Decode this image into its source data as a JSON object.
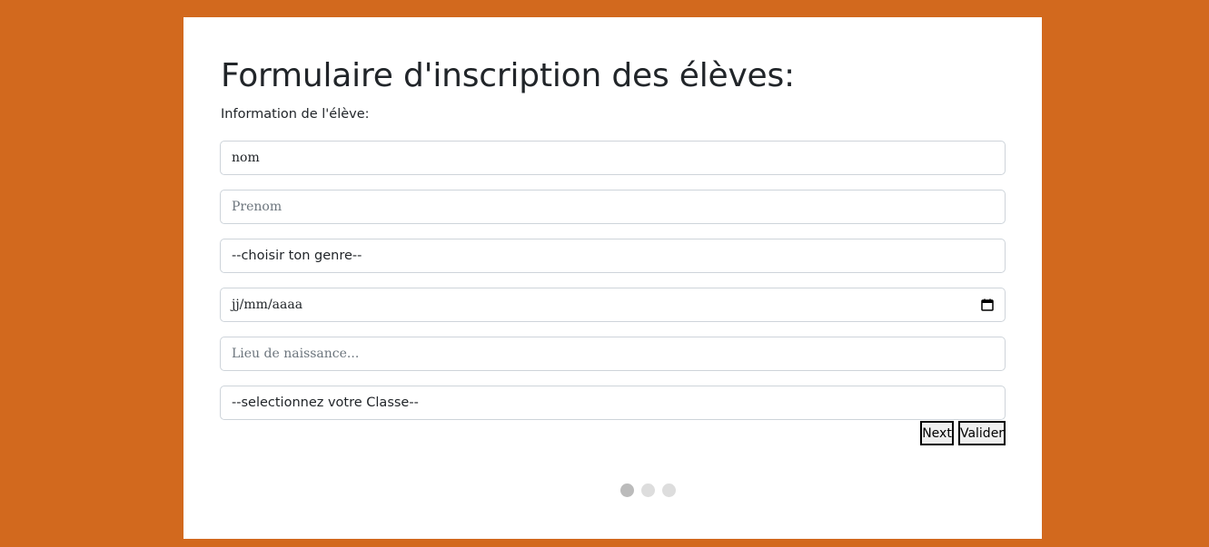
{
  "page": {
    "title": "Formulaire d'inscription des élèves:",
    "subtitle": "Information de l'élève:"
  },
  "form": {
    "nom": {
      "value": "nom",
      "placeholder": ""
    },
    "prenom": {
      "value": "",
      "placeholder": "Prenom"
    },
    "genre": {
      "selected": "--choisir ton genre--"
    },
    "date_naissance": {
      "display": "jj/mm/aaaa",
      "icon": "calendar-icon"
    },
    "lieu_naissance": {
      "value": "",
      "placeholder": "Lieu de naissance..."
    },
    "classe": {
      "selected": "--selectionnez votre Classe--"
    }
  },
  "buttons": {
    "next_label": "Next",
    "valider_label": "Valider"
  },
  "progress": {
    "steps": 3,
    "current_step": 1
  },
  "colors": {
    "background": "#d2691e",
    "card": "#ffffff",
    "text": "#212529",
    "border": "#ced4da",
    "dot_active": "#bbbbbb",
    "dot_inactive": "#dddddd"
  }
}
